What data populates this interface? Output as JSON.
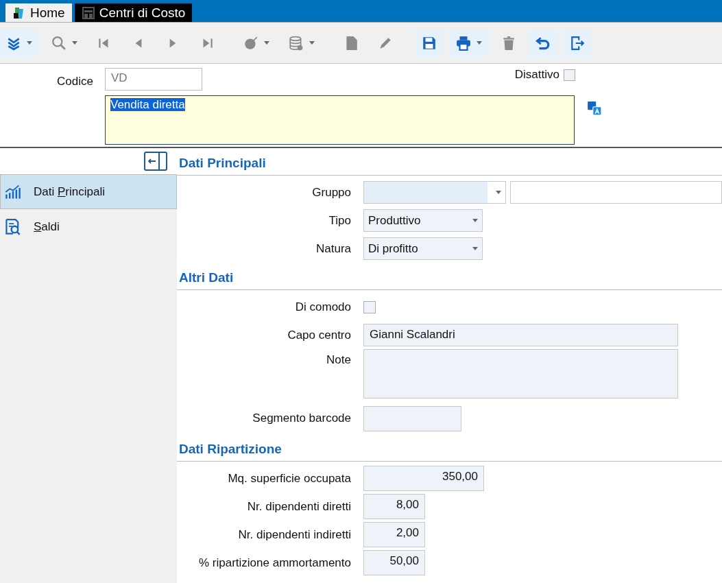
{
  "window": {
    "tabs": [
      {
        "label": "Home",
        "selected": false
      },
      {
        "label": "Centri di Costo",
        "selected": true
      }
    ]
  },
  "toolbar": [
    {
      "dropdown": true,
      "disabled": false
    },
    {
      "dropdown": true,
      "disabled": true
    },
    {
      "dropdown": false,
      "disabled": true
    },
    {
      "dropdown": false,
      "disabled": true
    },
    {
      "dropdown": false,
      "disabled": true
    },
    {
      "dropdown": false,
      "disabled": true
    },
    {
      "dropdown": true,
      "disabled": true
    },
    {
      "dropdown": true,
      "disabled": true
    },
    {
      "dropdown": false,
      "disabled": true
    },
    {
      "dropdown": false,
      "disabled": true
    },
    {
      "dropdown": false,
      "disabled": false
    },
    {
      "dropdown": true,
      "disabled": false
    },
    {
      "dropdown": false,
      "disabled": true
    },
    {
      "dropdown": false,
      "disabled": false
    },
    {
      "dropdown": false,
      "disabled": false
    }
  ],
  "header": {
    "code_label": "Codice",
    "code_value": "VD",
    "inactive_label": "Disattivo",
    "inactive_checked": false,
    "description": "Vendita diretta",
    "description_selected": true
  },
  "sidebar": {
    "items": [
      {
        "label": "Dati Principali",
        "selected": true
      },
      {
        "label": "Saldi",
        "selected": false
      }
    ]
  },
  "sections": [
    {
      "title": "Dati Principali",
      "fields": [
        {
          "kind": "combo-text",
          "label": "Gruppo"
        },
        {
          "kind": "combo",
          "label": "Tipo",
          "value": "Produttivo"
        },
        {
          "kind": "combo",
          "label": "Natura",
          "value": "Di profitto"
        }
      ]
    },
    {
      "title": "Altri Dati",
      "fields": [
        {
          "kind": "checkbox",
          "label": "Di comodo",
          "checked": false
        },
        {
          "kind": "text",
          "label": "Capo centro",
          "value": "Gianni Scalandri"
        },
        {
          "kind": "textarea",
          "label": "Note"
        },
        {
          "kind": "short",
          "label": "Segmento barcode"
        }
      ]
    },
    {
      "title": "Dati Ripartizione",
      "fields": [
        {
          "kind": "number-wide",
          "label": "Mq. superficie occupata",
          "value": "350,00"
        },
        {
          "kind": "number",
          "label": "Nr. dipendenti diretti",
          "value": "8,00"
        },
        {
          "kind": "number",
          "label": "Nr. dipendenti indiretti",
          "value": "2,00"
        },
        {
          "kind": "number",
          "label": "% ripartizione ammortamento",
          "value": "50,00"
        }
      ]
    }
  ]
}
